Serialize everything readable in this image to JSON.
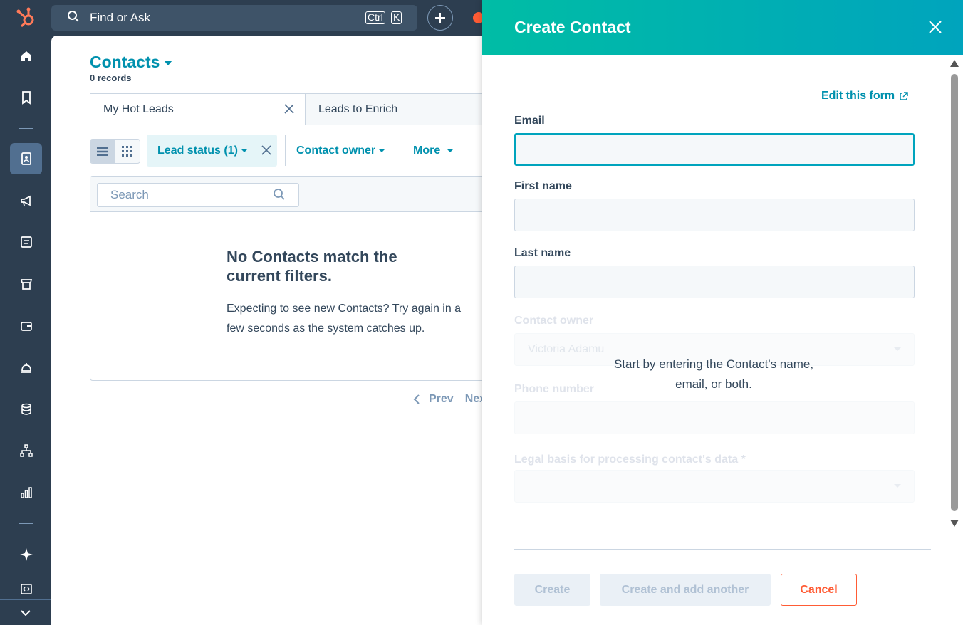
{
  "topbar": {
    "search_label": "Find or Ask",
    "shortcut_ctrl": "Ctrl",
    "shortcut_key": "K"
  },
  "rail": {
    "icons": [
      "home-icon",
      "bookmark-icon",
      "contacts-icon",
      "marketing-icon",
      "content-icon",
      "commerce-icon",
      "wallet-icon",
      "service-icon",
      "data-icon",
      "automation-icon",
      "reporting-icon",
      "ai-sparkle-icon",
      "developer-icon",
      "collapse-icon"
    ],
    "active": "contacts-icon"
  },
  "main": {
    "title": "Contacts",
    "records": "0 records",
    "tabs": [
      {
        "label": "My Hot Leads"
      },
      {
        "label": "Leads to Enrich"
      }
    ],
    "filters": {
      "lead_status": "Lead status (1)",
      "contact_owner": "Contact owner",
      "more": "More"
    },
    "search_placeholder": "Search",
    "empty_title": "No Contacts match the current filters.",
    "empty_body": "Expecting to see new Contacts? Try again in a few seconds as the system catches up.",
    "pager": {
      "prev": "Prev",
      "next": "Next"
    }
  },
  "panel": {
    "title": "Create Contact",
    "edit_form": "Edit this form",
    "fields": {
      "email_label": "Email",
      "first_name_label": "First name",
      "last_name_label": "Last name",
      "contact_owner_label": "Contact owner",
      "contact_owner_value": "Victoria Adamu",
      "phone_label": "Phone number",
      "legal_basis_label": "Legal basis for processing contact's data *"
    },
    "hint": "Start by entering the Contact's name, email, or both.",
    "buttons": {
      "create": "Create",
      "create_another": "Create and add another",
      "cancel": "Cancel"
    }
  },
  "colors": {
    "accent": "#0091ae",
    "header_gradient_start": "#00bda5",
    "header_gradient_end": "#00a4bd",
    "cancel": "#ff5c35",
    "rail": "#2d3e50"
  }
}
